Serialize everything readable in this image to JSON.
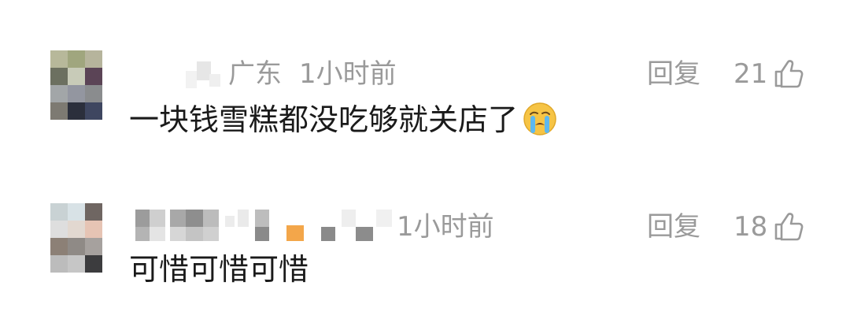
{
  "comments": [
    {
      "location": "广东",
      "time": "1小时前",
      "reply_label": "回复",
      "likes": "21",
      "text": "一块钱雪糕都没吃够就关店了",
      "emoji": "crying-face-icon"
    },
    {
      "location": "",
      "time": "1小时前",
      "reply_label": "回复",
      "likes": "18",
      "text": "可惜可惜可惜"
    }
  ],
  "colors": {
    "meta_text": "#9a9a9a",
    "body_text": "#1a1a1a",
    "background": "#ffffff"
  }
}
